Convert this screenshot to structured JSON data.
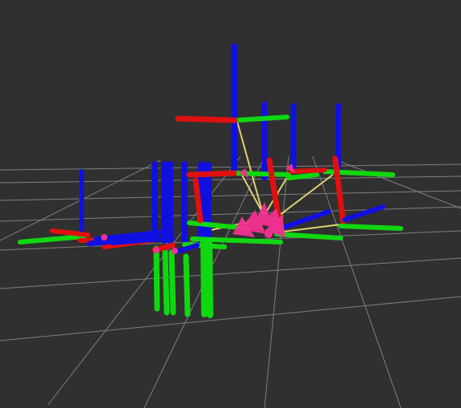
{
  "view": {
    "type": "3d-visualization",
    "background_color": "#303030",
    "grid_color": "#a0a0a0",
    "axis_colors": {
      "x_axis": "#e01010",
      "y_axis": "#10d810",
      "z_axis": "#1010e0"
    },
    "link_color": "#e0d070",
    "marker_color": "#f03090",
    "description": ""
  }
}
